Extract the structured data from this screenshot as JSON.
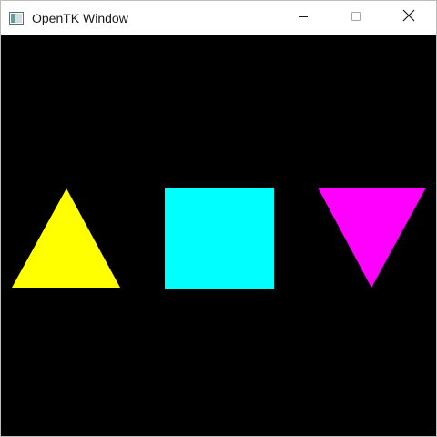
{
  "window": {
    "title": "OpenTK Window",
    "controls": [
      "minimize",
      "maximize",
      "close"
    ],
    "background_color": "#000000"
  },
  "icons": {
    "app": "opentk-app-icon",
    "minimize": "minimize-icon",
    "maximize": "maximize-icon",
    "close": "close-icon"
  },
  "shapes": [
    {
      "type": "triangle-up",
      "color": "#ffff00"
    },
    {
      "type": "square",
      "color": "#00ffff"
    },
    {
      "type": "triangle-down",
      "color": "#ff00ff"
    }
  ]
}
